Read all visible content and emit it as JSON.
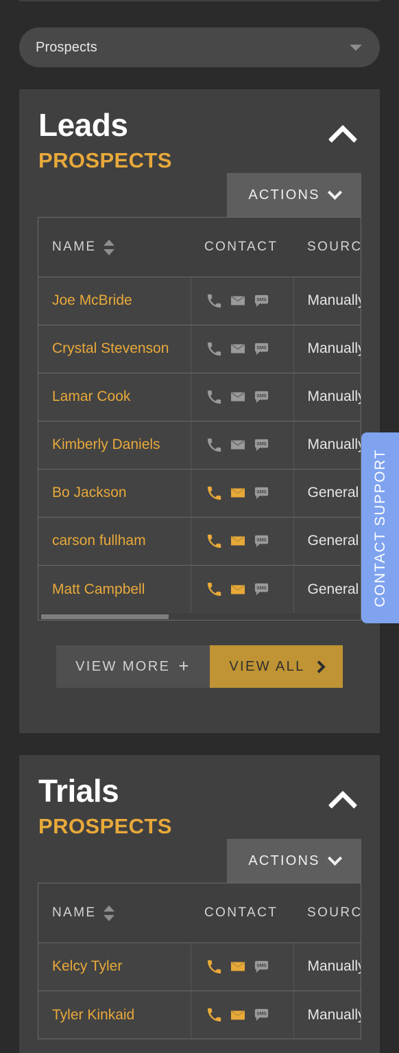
{
  "filter_select": {
    "value": "Prospects",
    "icon": "caret-down-icon"
  },
  "sections": [
    {
      "id": "leads",
      "title": "Leads",
      "subtitle": "PROSPECTS",
      "collapse_icon": "chevron-up-icon",
      "actions_label": "ACTIONS",
      "actions_icon": "chevron-down-icon",
      "columns": [
        "NAME",
        "CONTACT",
        "SOURCE"
      ],
      "rows": [
        {
          "name": "Joe McBride",
          "source": "Manually Added",
          "phone_active": false,
          "email_active": false,
          "sms_active": false
        },
        {
          "name": "Crystal Stevenson",
          "source": "Manually Added",
          "phone_active": false,
          "email_active": false,
          "sms_active": false
        },
        {
          "name": "Lamar Cook",
          "source": "Manually Added",
          "phone_active": false,
          "email_active": false,
          "sms_active": false
        },
        {
          "name": "Kimberly Daniels",
          "source": "Manually Added",
          "phone_active": false,
          "email_active": false,
          "sms_active": false
        },
        {
          "name": "Bo Jackson",
          "source": "General",
          "phone_active": true,
          "email_active": true,
          "sms_active": false
        },
        {
          "name": "carson fullham",
          "source": "General",
          "phone_active": true,
          "email_active": true,
          "sms_active": false
        },
        {
          "name": "Matt Campbell",
          "source": "General",
          "phone_active": true,
          "email_active": true,
          "sms_active": false
        }
      ],
      "view_more_label": "VIEW MORE",
      "view_more_icon": "plus-icon",
      "view_all_label": "VIEW ALL",
      "view_all_icon": "chevron-right-icon"
    },
    {
      "id": "trials",
      "title": "Trials",
      "subtitle": "PROSPECTS",
      "collapse_icon": "chevron-up-icon",
      "actions_label": "ACTIONS",
      "actions_icon": "chevron-down-icon",
      "columns": [
        "NAME",
        "CONTACT",
        "SOURCE"
      ],
      "rows": [
        {
          "name": "Kelcy Tyler",
          "source": "Manually Added",
          "phone_active": true,
          "email_active": true,
          "sms_active": false
        },
        {
          "name": "Tyler Kinkaid",
          "source": "Manually Added",
          "phone_active": true,
          "email_active": true,
          "sms_active": false
        }
      ]
    }
  ],
  "support_tab": {
    "label": "CONTACT SUPPORT"
  },
  "colors": {
    "page_bg": "#2b2b2b",
    "card_bg": "#404040",
    "accent_orange": "#e8a93a",
    "button_gold": "#c09434",
    "support_blue": "#7fa3ef",
    "icon_inactive": "#9a9a9a"
  }
}
